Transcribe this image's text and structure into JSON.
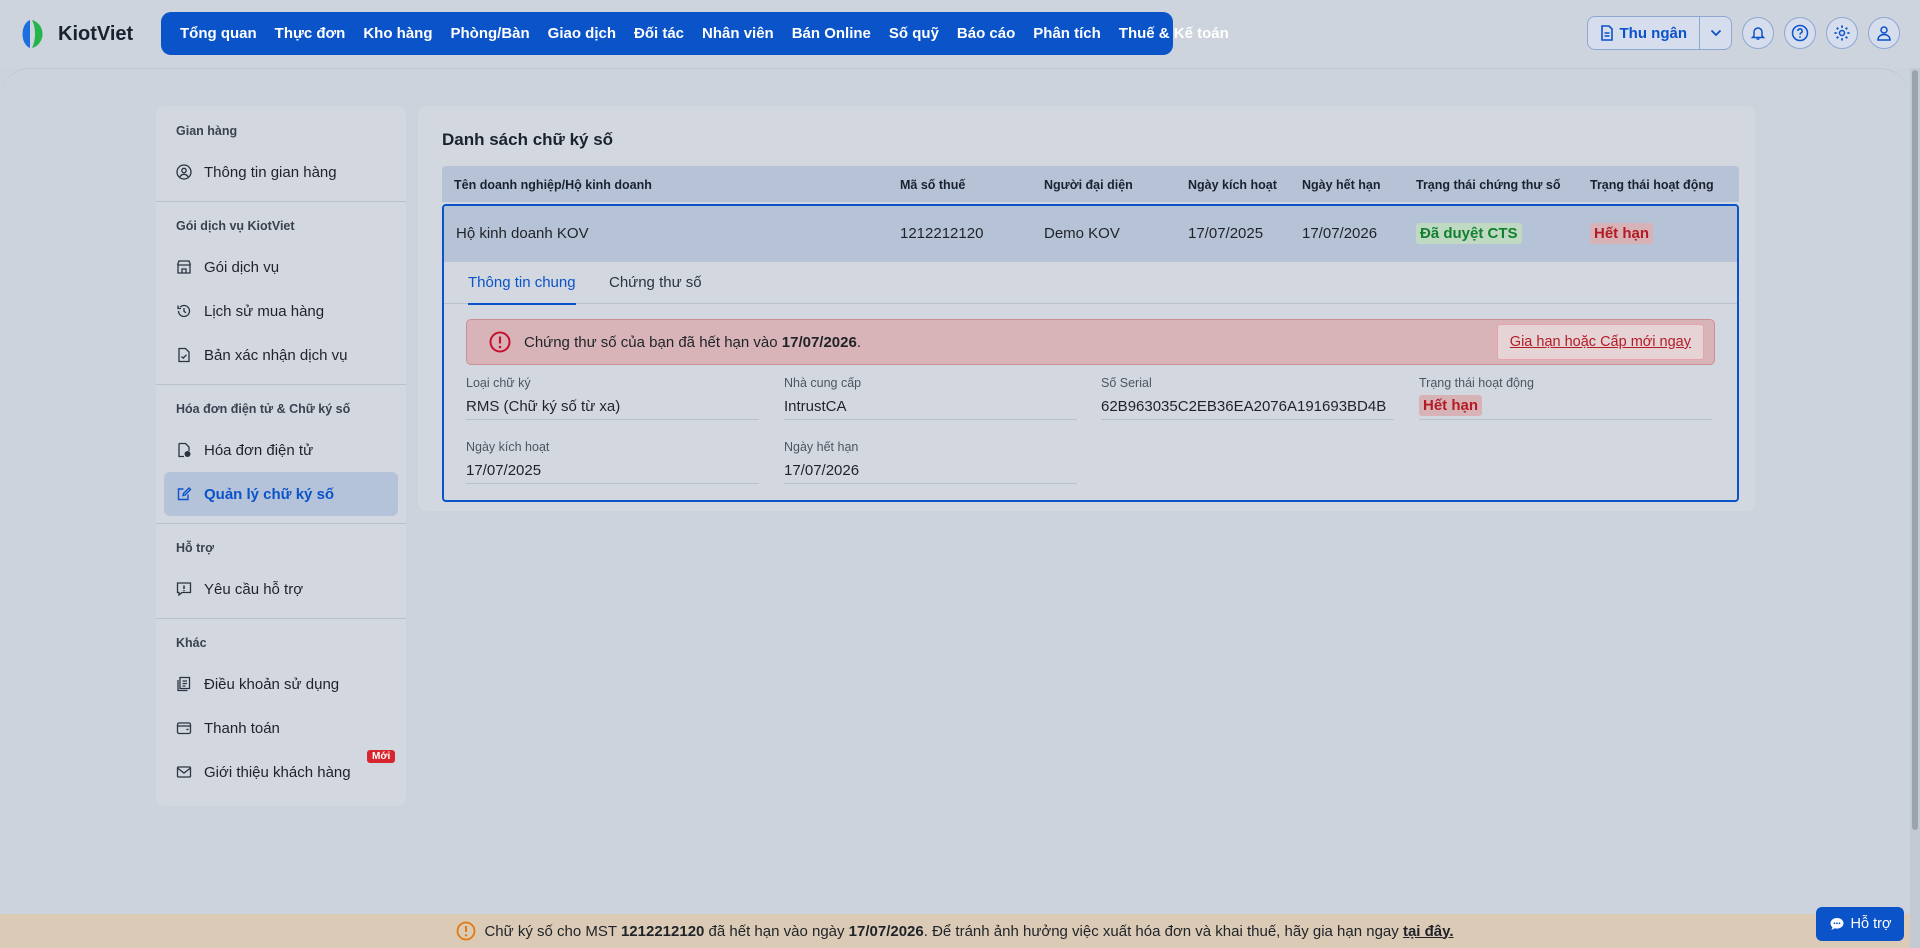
{
  "app": {
    "name": "KiotViet"
  },
  "nav": {
    "items": [
      "Tổng quan",
      "Thực đơn",
      "Kho hàng",
      "Phòng/Bàn",
      "Giao dịch",
      "Đối tác",
      "Nhân viên",
      "Bán Online",
      "Số quỹ",
      "Báo cáo",
      "Phân tích",
      "Thuế & Kế toán"
    ]
  },
  "tools": {
    "cashier_label": "Thu ngân"
  },
  "sidebar": {
    "groups": [
      {
        "heading": "Gian hàng",
        "items": [
          {
            "label": "Thông tin gian hàng",
            "icon": "user-circle-icon"
          }
        ]
      },
      {
        "heading": "Gói dịch vụ KiotViet",
        "items": [
          {
            "label": "Gói dịch vụ",
            "icon": "store-icon"
          },
          {
            "label": "Lịch sử mua hàng",
            "icon": "history-icon"
          },
          {
            "label": "Bản xác nhận dịch vụ",
            "icon": "document-icon"
          }
        ]
      },
      {
        "heading": "Hóa đơn điện tử & Chữ ký số",
        "items": [
          {
            "label": "Hóa đơn điện tử",
            "icon": "invoice-icon"
          },
          {
            "label": "Quản lý chữ ký số",
            "icon": "signature-icon",
            "active": true
          }
        ]
      },
      {
        "heading": "Hỗ trợ",
        "items": [
          {
            "label": "Yêu cầu hỗ trợ",
            "icon": "support-icon"
          }
        ]
      },
      {
        "heading": "Khác",
        "items": [
          {
            "label": "Điều khoản sử dụng",
            "icon": "terms-icon"
          },
          {
            "label": "Thanh toán",
            "icon": "wallet-icon"
          },
          {
            "label": "Giới thiệu khách hàng",
            "icon": "mail-icon",
            "badge": "Mới"
          }
        ]
      }
    ]
  },
  "page": {
    "title": "Danh sách chữ ký số",
    "columns": [
      "Tên doanh nghiệp/Hộ kinh doanh",
      "Mã số thuế",
      "Người đại diện",
      "Ngày kích hoạt",
      "Ngày hết hạn",
      "Trạng thái chứng thư số",
      "Trạng thái hoạt động"
    ],
    "row": {
      "name": "Hộ kinh doanh KOV",
      "tax_code": "1212212120",
      "representative": "Demo KOV",
      "activated": "17/07/2025",
      "expires": "17/07/2026",
      "cert_status": "Đã duyệt CTS",
      "op_status": "Hết hạn"
    },
    "tabs": [
      "Thông tin chung",
      "Chứng thư số"
    ],
    "alert": {
      "text_prefix": "Chứng thư số của bạn đã hết hạn vào ",
      "date": "17/07/2026",
      "text_suffix": ".",
      "action": "Gia hạn hoặc Cấp mới ngay"
    },
    "fields": [
      {
        "label": "Loại chữ ký",
        "value": "RMS (Chữ ký số từ xa)"
      },
      {
        "label": "Nhà cung cấp",
        "value": "IntrustCA"
      },
      {
        "label": "Số Serial",
        "value": "62B963035C2EB36EA2076A191693BD4B"
      },
      {
        "label": "Trạng thái hoạt động",
        "value": "Hết hạn"
      },
      {
        "label": "Ngày kích hoạt",
        "value": "17/07/2025"
      },
      {
        "label": "Ngày hết hạn",
        "value": "17/07/2026"
      }
    ]
  },
  "banner": {
    "p1": "Chữ ký số cho MST ",
    "mst": "1212212120",
    "p2": " đã hết hạn vào ngày ",
    "date": "17/07/2026",
    "p3": ". Để tránh ảnh hưởng việc xuất hóa đơn và khai thuế, hãy gia hạn ngay ",
    "link": "tại đây."
  },
  "support": {
    "label": "Hỗ trợ"
  },
  "colors": {
    "brand": "#0a53c9",
    "success": "#11802f",
    "danger": "#b31b25",
    "warning": "#e07a10"
  }
}
